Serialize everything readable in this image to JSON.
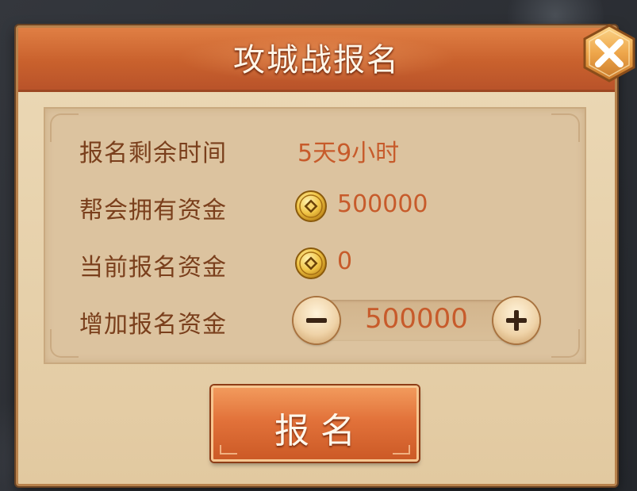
{
  "dialog": {
    "title": "攻城战报名",
    "close_icon": "close-icon"
  },
  "rows": [
    {
      "label": "报名剩余时间",
      "value": "5天9小时",
      "icon": null
    },
    {
      "label": "帮会拥有资金",
      "value": "500000",
      "icon": "coin-icon"
    },
    {
      "label": "当前报名资金",
      "value": "0",
      "icon": "coin-icon"
    },
    {
      "label": "增加报名资金",
      "value": "500000",
      "icon": null
    }
  ],
  "stepper": {
    "decrement_icon": "minus-icon",
    "increment_icon": "plus-icon",
    "value": "500000"
  },
  "submit": {
    "label": "报名"
  },
  "colors": {
    "title_bar": "#c9612d",
    "panel_bg": "#e6d0aa",
    "label_text": "#7a3f1c",
    "value_text": "#c75b2b",
    "button": "#e2723a"
  }
}
